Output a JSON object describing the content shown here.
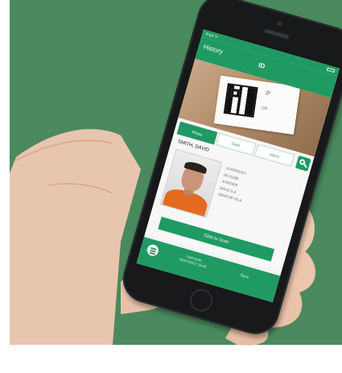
{
  "status": {
    "carrier": "iPad ᯤ"
  },
  "app": {
    "history_label": "History",
    "title": "ID"
  },
  "label_photo": {
    "code_text": "YE",
    "small_text": "DG"
  },
  "tabs": [
    {
      "label": "Photo",
      "active": true
    },
    {
      "label": "Data",
      "active": false
    },
    {
      "label": "Alerts",
      "active": false
    }
  ],
  "person": {
    "name": "SMITH, DAVID",
    "details": [
      "10-0000101?",
      "06-01186",
      "4/16/2006",
      "MALE-5-A",
      "GENPOP-02-A"
    ]
  },
  "scan_button": "Click to Scan",
  "footer": {
    "last_scan_label": "Last scan:",
    "last_scan_time": "02/07/2017 16:45",
    "sync_label": "Sync"
  },
  "colors": {
    "background": "#4a8a5e",
    "app_green": "#1f9a63",
    "inmate_shirt": "#e46a1f"
  },
  "icons": [
    "search-icon",
    "menu-icon",
    "qr-code-icon",
    "battery-icon"
  ]
}
